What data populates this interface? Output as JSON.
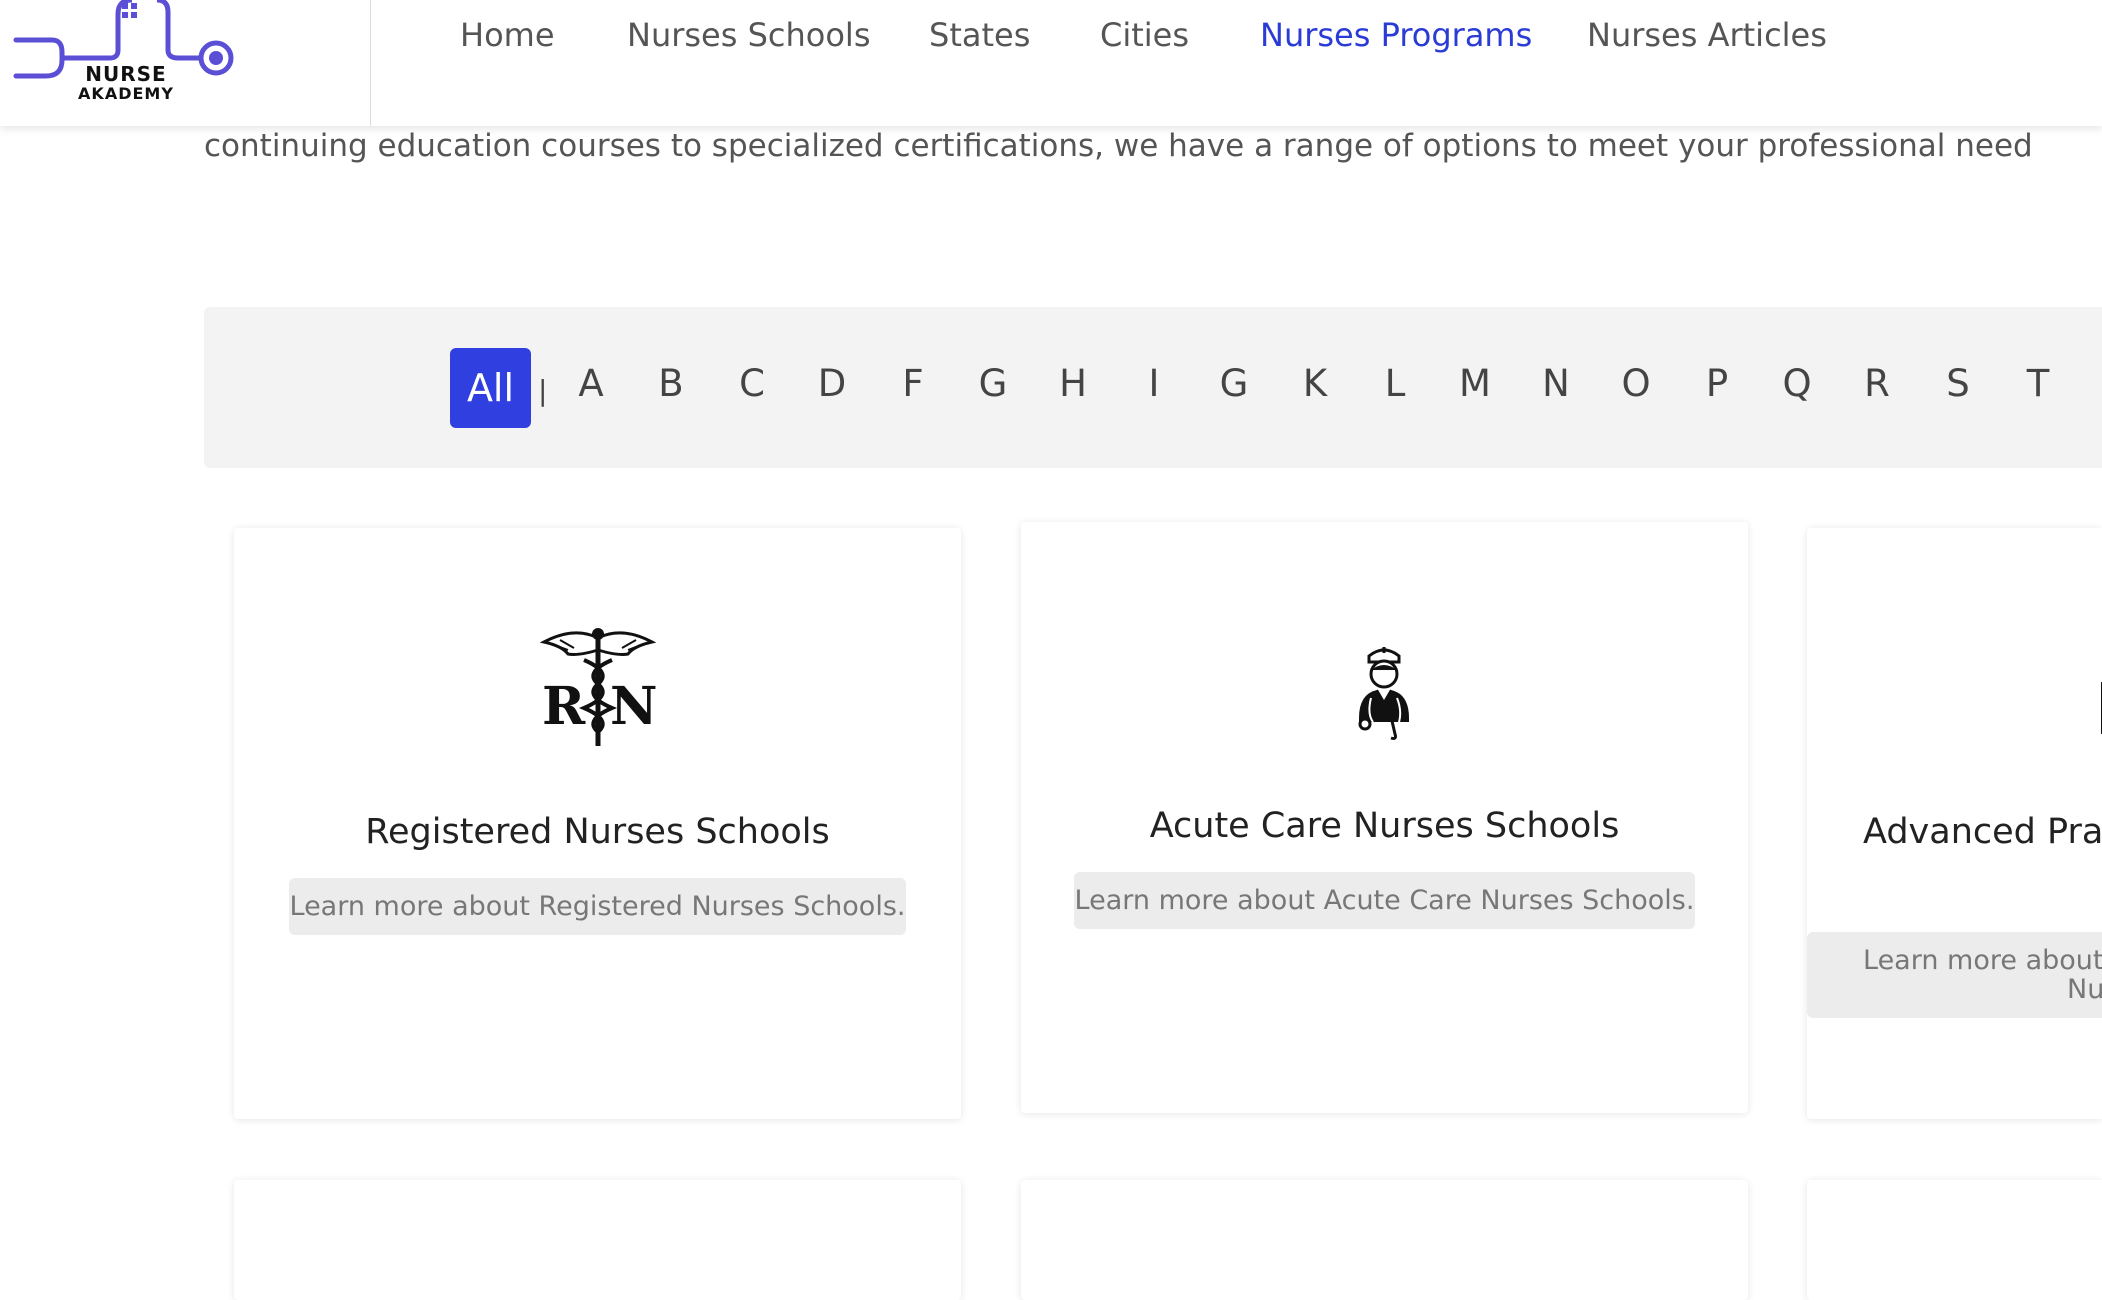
{
  "header": {
    "logo_line1": "NURSE",
    "logo_line2": "AKADEMY",
    "nav": [
      {
        "label": "Home"
      },
      {
        "label": "Nurses Schools"
      },
      {
        "label": "States"
      },
      {
        "label": "Cities"
      },
      {
        "label": "Nurses Programs",
        "active": true
      },
      {
        "label": "Nurses Articles"
      }
    ],
    "accent_color": "#2b3bd6",
    "logo_color": "#5b4fd6"
  },
  "intro_text": "continuing education courses to specialized certifications, we have a range of options to meet your professional need",
  "alphabet": {
    "active": "All",
    "letters": [
      "A",
      "B",
      "C",
      "D",
      "F",
      "G",
      "H",
      "I",
      "G",
      "K",
      "L",
      "M",
      "N",
      "O",
      "P",
      "Q",
      "R",
      "S",
      "T"
    ]
  },
  "cards": [
    {
      "title": "Registered Nurses Schools",
      "link": "Learn more about Registered Nurses Schools.",
      "icon": "rn-caduceus-icon"
    },
    {
      "title": "Acute Care Nurses Schools",
      "link": "Learn more about Acute Care Nurses Schools.",
      "icon": "nurse-figure-icon"
    },
    {
      "title": "Advanced Prac",
      "link_line1": "Learn more about",
      "link_line2": "Nu",
      "icon": "nurse-icon"
    }
  ]
}
